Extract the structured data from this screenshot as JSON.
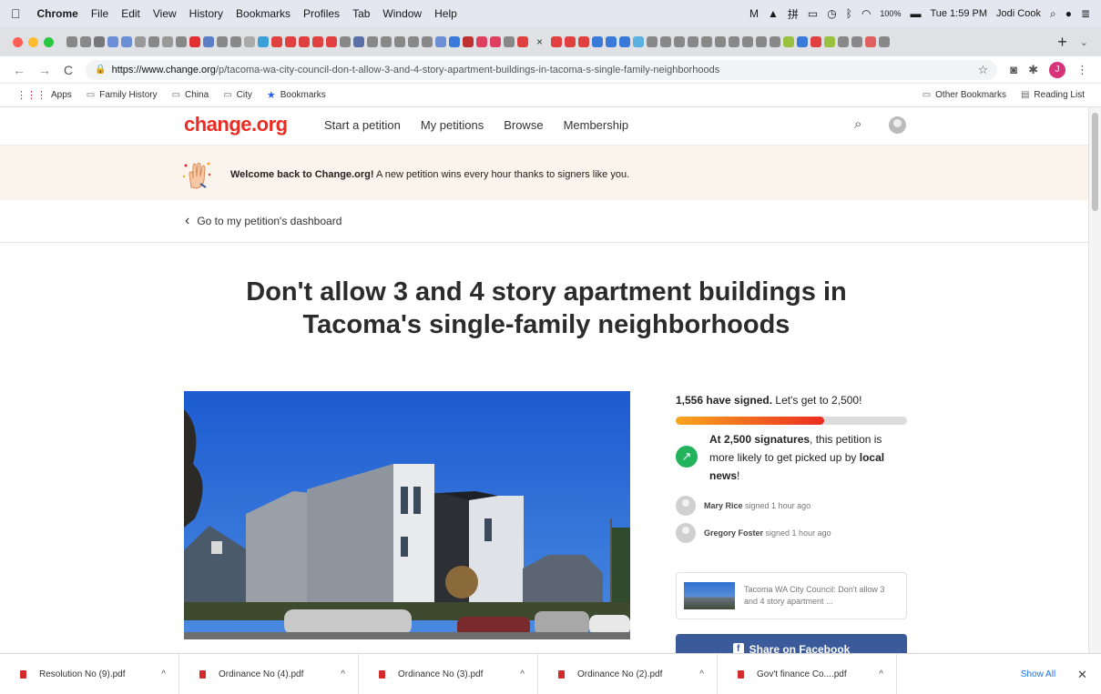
{
  "menubar": {
    "app": "Chrome",
    "items": [
      "File",
      "Edit",
      "View",
      "History",
      "Bookmarks",
      "Profiles",
      "Tab",
      "Window",
      "Help"
    ],
    "battery": "100%",
    "time": "Tue 1:59 PM",
    "user": "Jodi Cook"
  },
  "browser": {
    "url_host": "https://www.change.org",
    "url_path": "/p/tacoma-wa-city-council-don-t-allow-3-and-4-story-apartment-buildings-in-tacoma-s-single-family-neighborhoods",
    "profile_initial": "J",
    "new_tab_label": "+",
    "tab_close_label": "×"
  },
  "bookmarks": {
    "items": [
      "Apps",
      "Family History",
      "China",
      "City",
      "Bookmarks"
    ],
    "other": "Other Bookmarks",
    "reading_list": "Reading List"
  },
  "site": {
    "logo": "change.org",
    "nav": [
      "Start a petition",
      "My petitions",
      "Browse",
      "Membership"
    ]
  },
  "banner": {
    "bold": "Welcome back to Change.org!",
    "rest": " A new petition wins every hour thanks to signers like you."
  },
  "dashboard_link": "Go to my petition's dashboard",
  "petition": {
    "title_line1": "Don't allow 3 and 4 story apartment buildings in",
    "title_line2": "Tacoma's single-family neighborhoods",
    "signed_count": "1,556 have signed.",
    "signed_goal": " Let's get to 2,500!",
    "progress": 0.64,
    "goal_bold": "At 2,500 signatures",
    "goal_text": ", this petition is more likely to get picked up by ",
    "goal_news": "local news",
    "goal_end": "!",
    "signers": [
      {
        "name": "Mary Rice",
        "time": " signed 1 hour ago"
      },
      {
        "name": "Gregory Foster",
        "time": " signed 1 hour ago"
      }
    ],
    "share_card_text": "Tacoma WA City Council: Don't allow 3 and 4 story apartment ...",
    "facebook_button": "Share on Facebook"
  },
  "downloads": {
    "items": [
      "Resolution No (9).pdf",
      "Ordinance No (4).pdf",
      "Ordinance No (3).pdf",
      "Ordinance No (2).pdf",
      "Gov't finance Co....pdf"
    ],
    "show_all": "Show All"
  },
  "colors": {
    "brand": "#ec2c22",
    "facebook": "#3b5a9a",
    "success": "#23b35d"
  }
}
